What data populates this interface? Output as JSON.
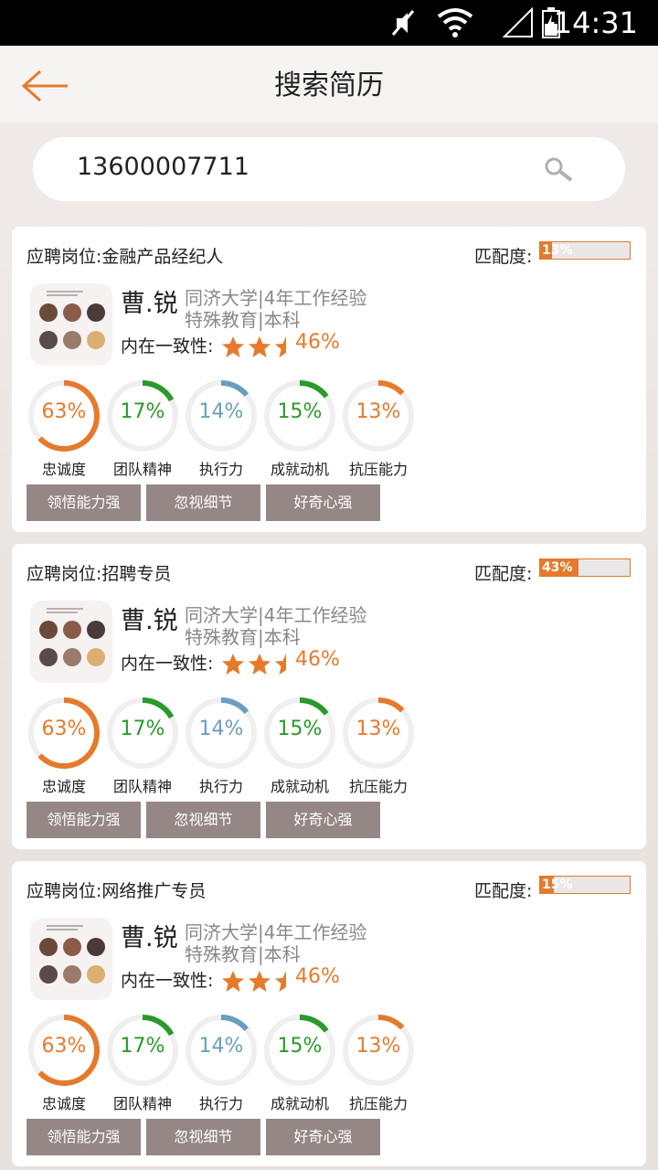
{
  "status_bar": {
    "time": "14:31"
  },
  "header": {
    "title": "搜索简历"
  },
  "search": {
    "value": "13600007711"
  },
  "colors": {
    "accent": "#e67a2c",
    "green": "#2a9a2a",
    "blue": "#6a9ec0",
    "tag": "#948785"
  },
  "labels": {
    "match": "匹配度:",
    "consistency": "内在一致性:"
  },
  "cards": [
    {
      "job": "应聘岗位:金融产品经纪人",
      "match_pct": 13,
      "match_text": "13%",
      "name": "曹.锐",
      "edu1": "同济大学|4年工作经验",
      "edu2": "特殊教育|本科",
      "stars": 2.5,
      "consistency": "46%",
      "metrics": [
        {
          "label": "忠诚度",
          "value": 63,
          "text": "63%",
          "color": "accent"
        },
        {
          "label": "团队精神",
          "value": 17,
          "text": "17%",
          "color": "green"
        },
        {
          "label": "执行力",
          "value": 14,
          "text": "14%",
          "color": "blue"
        },
        {
          "label": "成就动机",
          "value": 15,
          "text": "15%",
          "color": "green"
        },
        {
          "label": "抗压能力",
          "value": 13,
          "text": "13%",
          "color": "accent"
        }
      ],
      "tags": [
        "领悟能力强",
        "忽视细节",
        "好奇心强"
      ]
    },
    {
      "job": "应聘岗位:招聘专员",
      "match_pct": 43,
      "match_text": "43%",
      "name": "曹.锐",
      "edu1": "同济大学|4年工作经验",
      "edu2": "特殊教育|本科",
      "stars": 2.5,
      "consistency": "46%",
      "metrics": [
        {
          "label": "忠诚度",
          "value": 63,
          "text": "63%",
          "color": "accent"
        },
        {
          "label": "团队精神",
          "value": 17,
          "text": "17%",
          "color": "green"
        },
        {
          "label": "执行力",
          "value": 14,
          "text": "14%",
          "color": "blue"
        },
        {
          "label": "成就动机",
          "value": 15,
          "text": "15%",
          "color": "green"
        },
        {
          "label": "抗压能力",
          "value": 13,
          "text": "13%",
          "color": "accent"
        }
      ],
      "tags": [
        "领悟能力强",
        "忽视细节",
        "好奇心强"
      ]
    },
    {
      "job": "应聘岗位:网络推广专员",
      "match_pct": 15,
      "match_text": "15%",
      "name": "曹.锐",
      "edu1": "同济大学|4年工作经验",
      "edu2": "特殊教育|本科",
      "stars": 2.5,
      "consistency": "46%",
      "metrics": [
        {
          "label": "忠诚度",
          "value": 63,
          "text": "63%",
          "color": "accent"
        },
        {
          "label": "团队精神",
          "value": 17,
          "text": "17%",
          "color": "green"
        },
        {
          "label": "执行力",
          "value": 14,
          "text": "14%",
          "color": "blue"
        },
        {
          "label": "成就动机",
          "value": 15,
          "text": "15%",
          "color": "green"
        },
        {
          "label": "抗压能力",
          "value": 13,
          "text": "13%",
          "color": "accent"
        }
      ],
      "tags": [
        "领悟能力强",
        "忽视细节",
        "好奇心强"
      ]
    }
  ]
}
